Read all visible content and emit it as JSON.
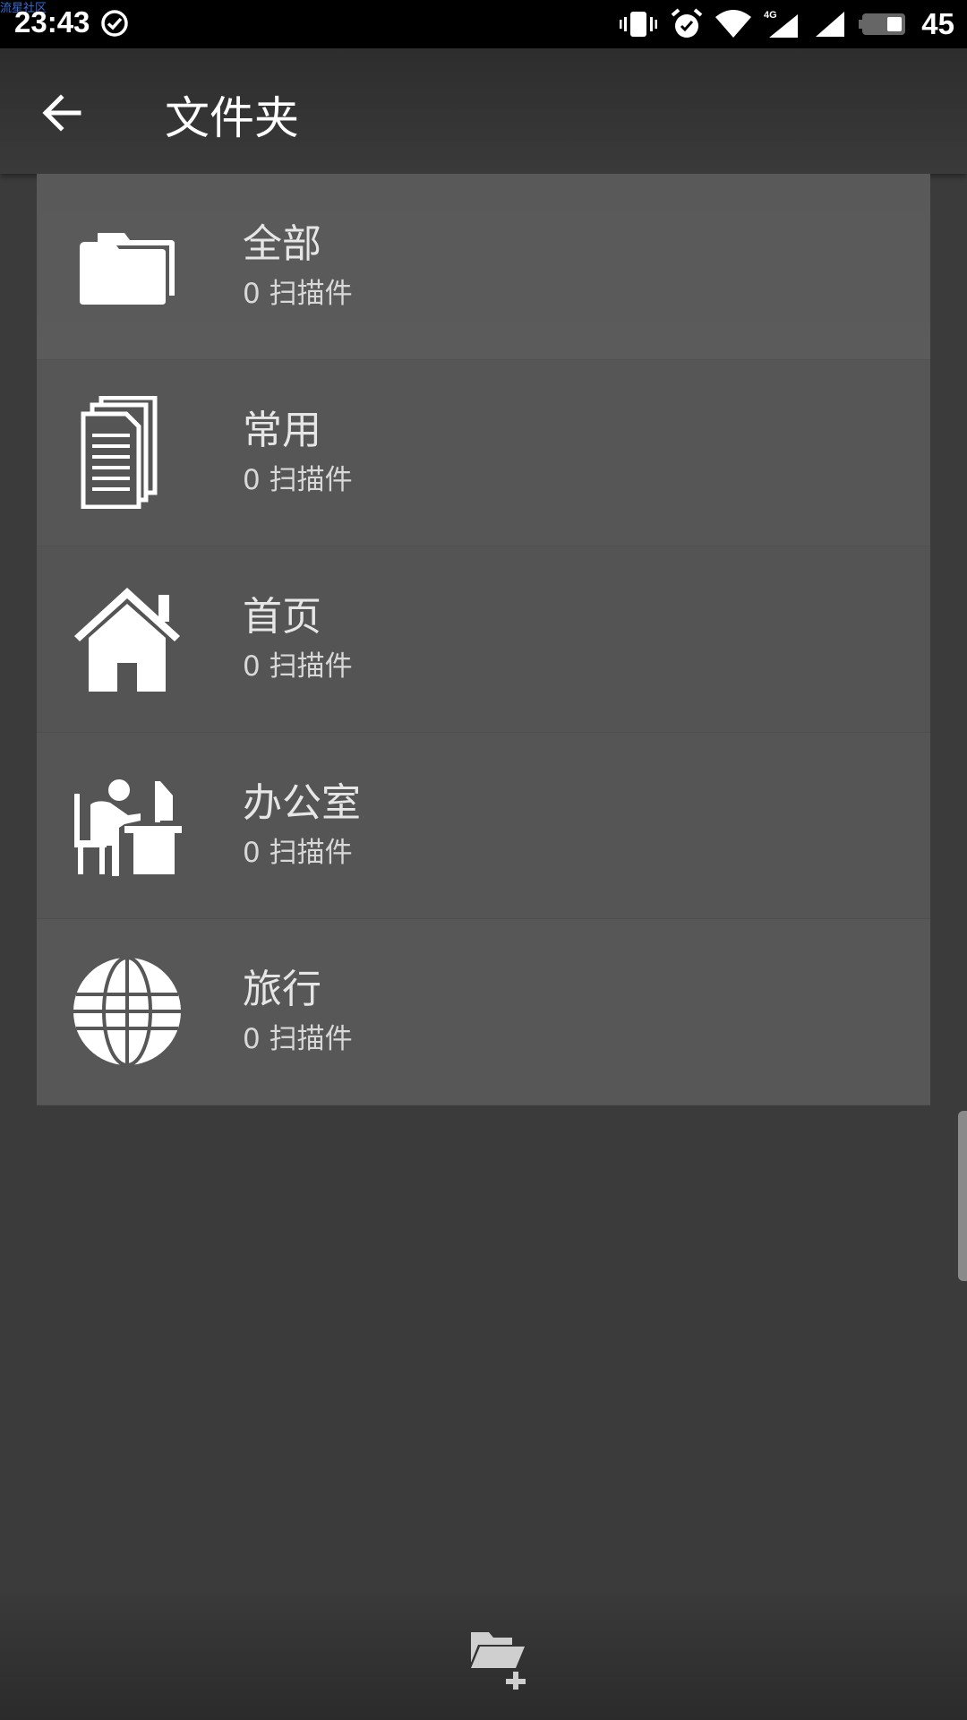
{
  "status_bar": {
    "watermark": "流星社区",
    "time": "23:43",
    "battery": "45",
    "icons": [
      "check-circle-icon",
      "vibrate-icon",
      "alarm-icon",
      "wifi-icon",
      "signal-4g-icon",
      "signal-icon",
      "battery-icon"
    ]
  },
  "header": {
    "title": "文件夹",
    "back_icon": "arrow-left-icon"
  },
  "folders": [
    {
      "name": "全部",
      "count": "0 扫描件",
      "icon": "folders-icon"
    },
    {
      "name": "常用",
      "count": "0 扫描件",
      "icon": "documents-icon"
    },
    {
      "name": "首页",
      "count": "0 扫描件",
      "icon": "home-icon"
    },
    {
      "name": "办公室",
      "count": "0 扫描件",
      "icon": "office-worker-icon"
    },
    {
      "name": "旅行",
      "count": "0 扫描件",
      "icon": "globe-icon"
    }
  ],
  "bottom_bar": {
    "action_icon": "new-folder-icon"
  }
}
